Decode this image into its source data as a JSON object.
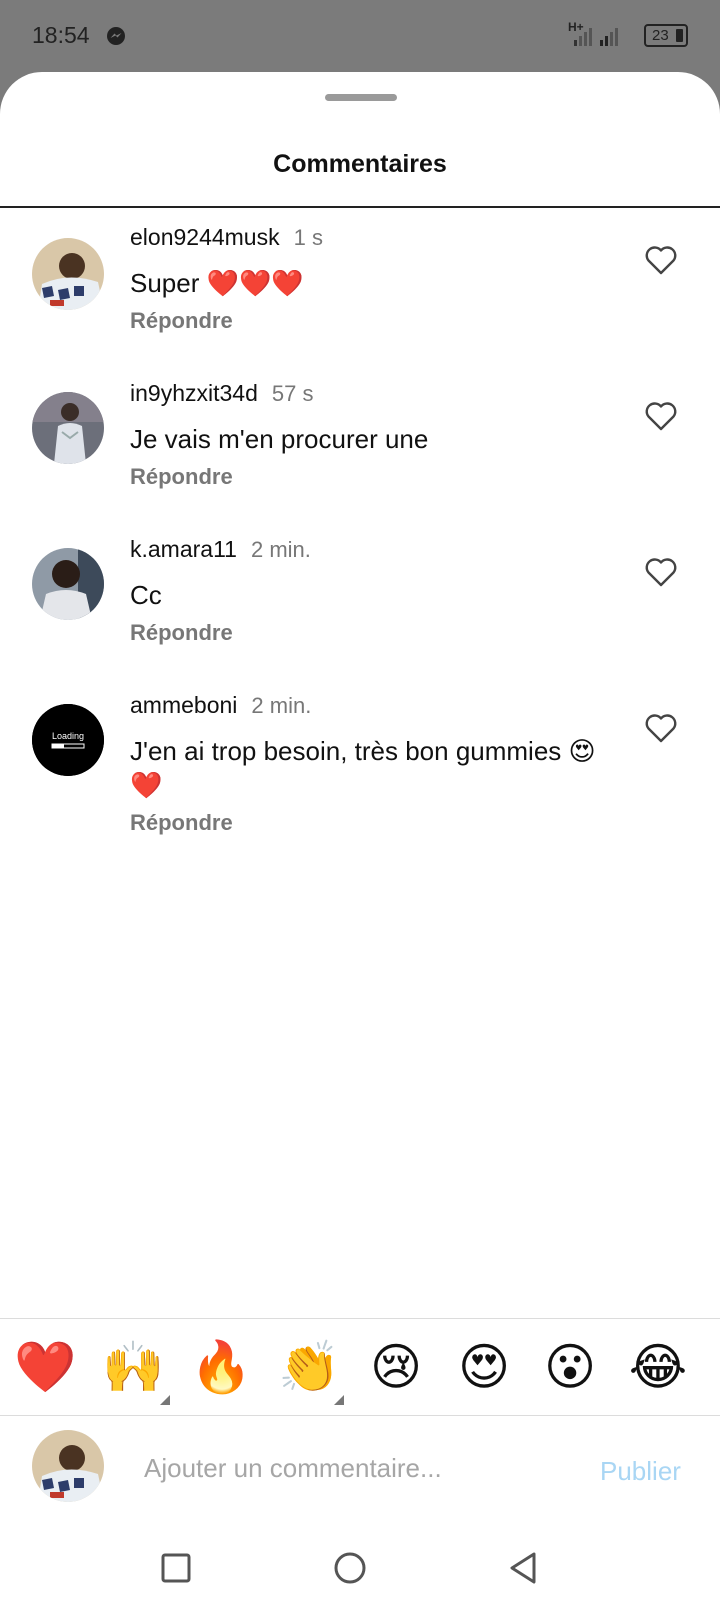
{
  "status_bar": {
    "time": "18:54",
    "network": "H+",
    "battery": "23"
  },
  "sheet": {
    "title": "Commentaires"
  },
  "comments": [
    {
      "username": "elon9244musk",
      "time": "1 s",
      "text": "Super ❤️❤️❤️",
      "reply": "Répondre",
      "avatar": "avatar-photo"
    },
    {
      "username": "in9yhzxit34d",
      "time": "57 s",
      "text": "Je vais m'en procurer une",
      "reply": "Répondre",
      "avatar": "avatar-photo"
    },
    {
      "username": "k.amara11",
      "time": "2 min.",
      "text": "Cc",
      "reply": "Répondre",
      "avatar": "avatar-photo"
    },
    {
      "username": "ammeboni",
      "time": "2 min.",
      "text": "J'en ai trop besoin, très bon gummies 😍❤️",
      "reply": "Répondre",
      "avatar": "avatar-loading",
      "avatar_text": "Loading"
    }
  ],
  "emoji_bar": [
    "❤️",
    "🙌",
    "🔥",
    "👏",
    "😢",
    "😍",
    "😮",
    "😂"
  ],
  "composer": {
    "placeholder": "Ajouter un commentaire...",
    "publish_label": "Publier"
  },
  "colors": {
    "publish_disabled": "#a9d6f4",
    "meta_gray": "#777777",
    "divider": "#dcdcdc"
  }
}
